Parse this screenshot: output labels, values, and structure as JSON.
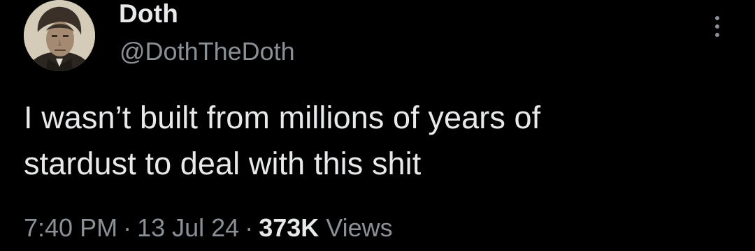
{
  "author": {
    "display_name": "Doth",
    "handle": "@DothTheDoth",
    "avatar_icon": "portrait-avatar"
  },
  "menu": {
    "icon": "more-vertical-icon"
  },
  "tweet": {
    "line1": "I wasn’t built from millions of years of",
    "line2": "stardust to deal with this shit"
  },
  "meta": {
    "time": "7:40 PM",
    "separator": "·",
    "date": "13 Jul 24",
    "views_count": "373K",
    "views_label": "Views"
  },
  "colors": {
    "background": "#000000",
    "primary_text": "#e7e9ea",
    "secondary_text": "#8b9096"
  }
}
